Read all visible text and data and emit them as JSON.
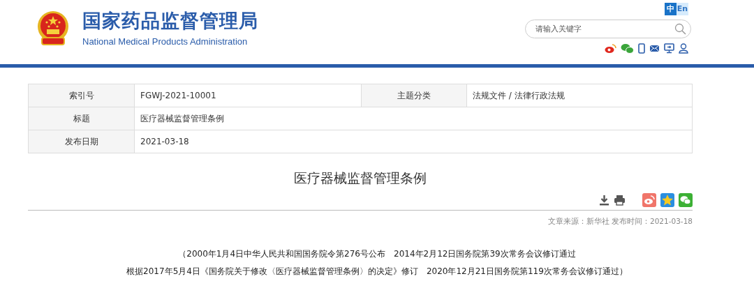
{
  "header": {
    "title": "国家药品监督管理局",
    "subtitle": "National Medical Products Administration",
    "languages": [
      {
        "label": "中",
        "selected": true
      },
      {
        "label": "En",
        "selected": false
      }
    ],
    "search": {
      "placeholder": "请输入关键字"
    }
  },
  "info_table": {
    "rows": [
      {
        "cells": [
          {
            "label": "索引号",
            "value": "FGWJ-2021-10001"
          },
          {
            "label": "主题分类",
            "value": "法规文件 / 法律行政法规"
          }
        ]
      },
      {
        "cells": [
          {
            "label": "标题",
            "value": "医疗器械监督管理条例"
          }
        ]
      },
      {
        "cells": [
          {
            "label": "发布日期",
            "value": "2021-03-18"
          }
        ]
      }
    ]
  },
  "article": {
    "title": "医疗器械监督管理条例",
    "source": "文章来源：新华社 发布时间：2021-03-18",
    "lines": [
      "（2000年1月4日中华人民共和国国务院令第276号公布　2014年2月12日国务院第39次常务会议修订通过",
      "根据2017年5月4日《国务院关于修改〈医疗器械监督管理条例〉的决定》修订　2020年12月21日国务院第119次常务会议修订通过）"
    ]
  }
}
